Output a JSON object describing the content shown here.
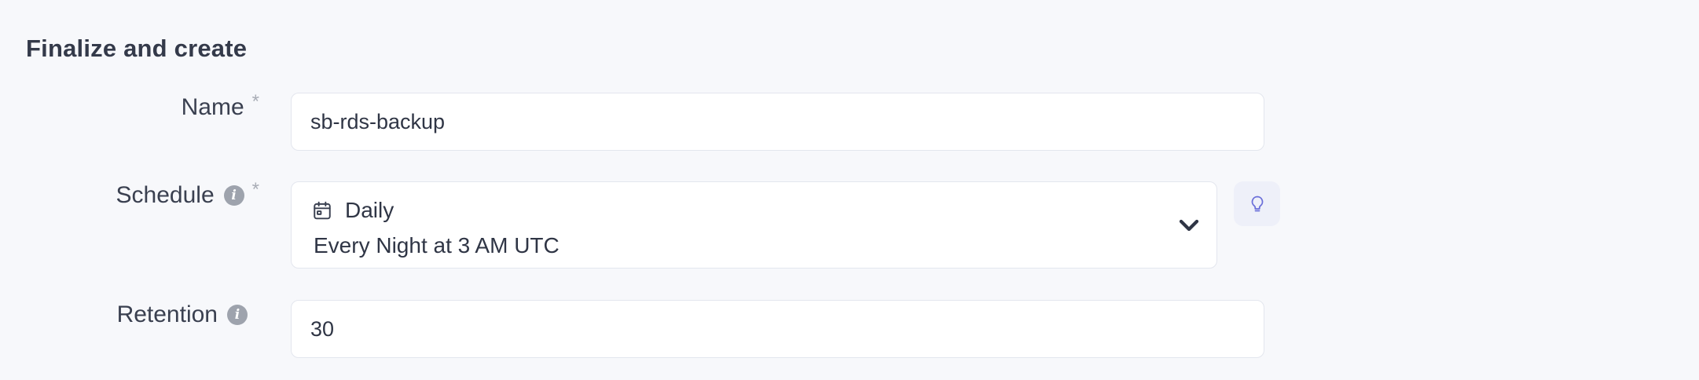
{
  "section": {
    "title": "Finalize and create"
  },
  "fields": {
    "name": {
      "label": "Name",
      "required_mark": "*",
      "value": "sb-rds-backup"
    },
    "schedule": {
      "label": "Schedule",
      "info_icon": "info-icon",
      "required_mark": "*",
      "selected_title": "Daily",
      "selected_description": "Every Night at 3 AM UTC",
      "icon": "calendar-icon",
      "dropdown_icon": "chevron-down-icon",
      "hint_icon": "lightbulb-icon"
    },
    "retention": {
      "label": "Retention",
      "info_icon": "info-icon",
      "value": "30"
    }
  },
  "colors": {
    "background": "#f7f8fb",
    "input_border": "#e3e6ee",
    "hint_button_bg": "#eef0f9",
    "hint_icon": "#6b6fd9",
    "info_icon_bg": "#9ea3ad"
  }
}
